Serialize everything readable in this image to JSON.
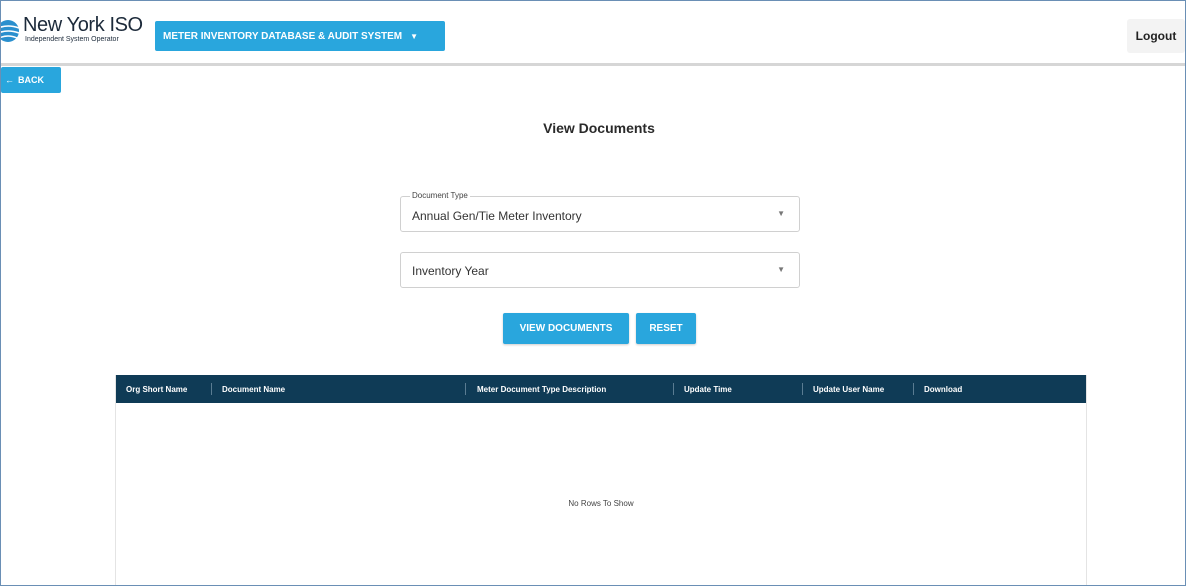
{
  "header": {
    "logo_title": "New York ISO",
    "logo_subtitle": "Independent System Operator",
    "system_menu_label": "METER INVENTORY DATABASE & AUDIT SYSTEM",
    "logout_label": "Logout"
  },
  "back_label": "BACK",
  "page_title": "View Documents",
  "form": {
    "document_type": {
      "legend": "Document Type",
      "value": "Annual Gen/Tie Meter Inventory"
    },
    "inventory_year": {
      "value": "Inventory Year"
    },
    "view_button": "VIEW DOCUMENTS",
    "reset_button": "RESET"
  },
  "grid": {
    "columns": [
      "Org Short Name",
      "Document Name",
      "Meter Document Type Description",
      "Update Time",
      "Update User Name",
      "Download"
    ],
    "empty_message": "No Rows To Show"
  },
  "colors": {
    "accent": "#29a6dd",
    "grid_header": "#0f3b56"
  },
  "icons": {
    "logo": "nyiso-globe-logo",
    "menu_caret": "caret-down-icon",
    "back_arrow": "arrow-left-icon",
    "select_arrow": "dropdown-arrow-icon"
  }
}
